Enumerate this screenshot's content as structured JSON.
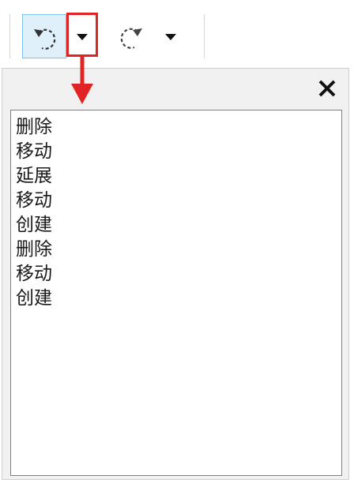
{
  "toolbar": {
    "undo_icon": "undo-icon",
    "redo_icon": "redo-icon",
    "dropdown_icon": "caret-down-icon"
  },
  "annotation": {
    "box_color": "#e02424",
    "arrow_color": "#e02424"
  },
  "panel": {
    "close_icon": "close-icon",
    "history": [
      {
        "label": "删除"
      },
      {
        "label": "移动"
      },
      {
        "label": "延展"
      },
      {
        "label": "移动"
      },
      {
        "label": "创建"
      },
      {
        "label": "删除"
      },
      {
        "label": "移动"
      },
      {
        "label": "创建"
      }
    ]
  }
}
